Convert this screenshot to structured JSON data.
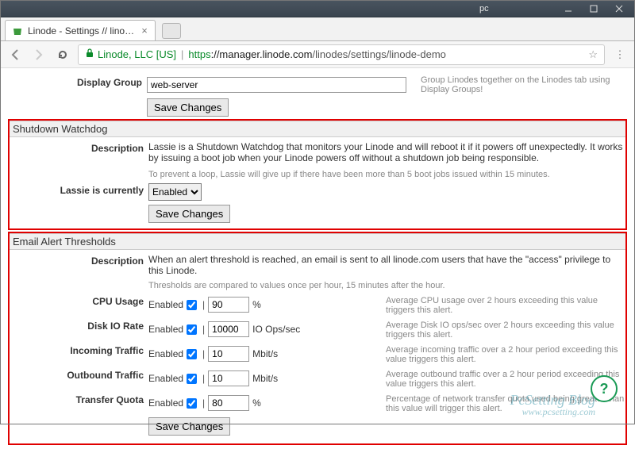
{
  "window": {
    "pc_label": "pc",
    "tab_title": "Linode - Settings // lino…"
  },
  "address": {
    "org": "Linode, LLC [US]",
    "full": "https://manager.linode.com/linodes/settings/linode-demo",
    "scheme": "https",
    "domain": "://manager.linode.com",
    "path": "/linodes/settings/linode-demo"
  },
  "display_group": {
    "label": "Display Group",
    "value": "web-server",
    "hint": "Group Linodes together on the Linodes tab using Display Groups!",
    "save": "Save Changes"
  },
  "watchdog": {
    "header": "Shutdown Watchdog",
    "desc_label": "Description",
    "desc1": "Lassie is a Shutdown Watchdog that monitors your Linode and will reboot it if it powers off unexpectedly. It works by issuing a boot job when your Linode powers off without a shutdown job being responsible.",
    "desc2": "To prevent a loop, Lassie will give up if there have been more than 5 boot jobs issued within 15 minutes.",
    "lassie_label": "Lassie is currently",
    "lassie_value": "Enabled",
    "save": "Save Changes"
  },
  "alerts": {
    "header": "Email Alert Thresholds",
    "desc_label": "Description",
    "desc": "When an alert threshold is reached, an email is sent to all linode.com users that have the \"access\" privilege to this Linode.",
    "hint": "Thresholds are compared to values once per hour, 15 minutes after the hour.",
    "enabled_text": "Enabled",
    "cpu": {
      "label": "CPU Usage",
      "value": "90",
      "unit": "%",
      "hint": "Average CPU usage over 2 hours exceeding this value triggers this alert."
    },
    "disk": {
      "label": "Disk IO Rate",
      "value": "10000",
      "unit": "IO Ops/sec",
      "hint": "Average Disk IO ops/sec over 2 hours exceeding this value triggers this alert."
    },
    "in": {
      "label": "Incoming Traffic",
      "value": "10",
      "unit": "Mbit/s",
      "hint": "Average incoming traffic over a 2 hour period exceeding this value triggers this alert."
    },
    "out": {
      "label": "Outbound Traffic",
      "value": "10",
      "unit": "Mbit/s",
      "hint": "Average outbound traffic over a 2 hour period exceeding this value triggers this alert."
    },
    "quota": {
      "label": "Transfer Quota",
      "value": "80",
      "unit": "%",
      "hint": "Percentage of network transfer quota used being greater than this value will trigger this alert."
    },
    "save": "Save Changes"
  },
  "watermark": {
    "line1": "PcSetting Blog",
    "line2": "www.pcsetting.com"
  }
}
